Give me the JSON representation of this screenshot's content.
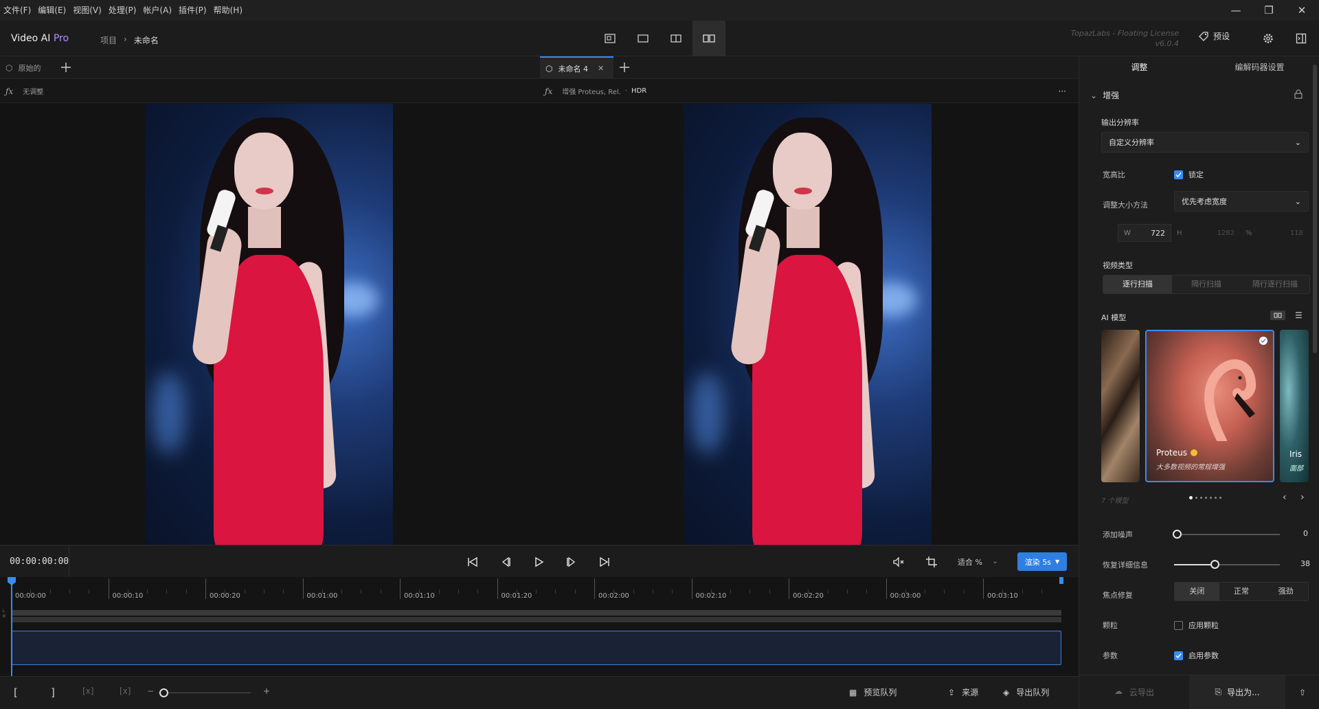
{
  "menu": [
    "文件(F)",
    "编辑(E)",
    "视图(V)",
    "处理(P)",
    "帐户(A)",
    "插件(P)",
    "帮助(H)"
  ],
  "window_controls": {
    "minimize": "—",
    "maximize": "❐",
    "close": "✕"
  },
  "header": {
    "app_name": "Video AI",
    "app_edition": "Pro",
    "breadcrumb_project": "项目",
    "breadcrumb_sep": "›",
    "breadcrumb_current": "未命名",
    "license_line1": "TopazLabs - Floating License",
    "license_line2": "v6.0.4",
    "preset_label": "预设"
  },
  "left_tab": {
    "label": "原始的",
    "adjust": "无调整"
  },
  "right_tab": {
    "label": "未命名 4",
    "adjust_prefix": "增强 Proteus, Rel.",
    "adjust_sep": "·",
    "adjust_hdr": "HDR",
    "more": "···"
  },
  "transport": {
    "timecode": "00:00:00:00",
    "fit_label": "适合 %",
    "render_label": "渲染 5s"
  },
  "timeline": {
    "ticks": [
      "00:00:00",
      "00:00:10",
      "00:00:20",
      "00:01:00",
      "00:01:10",
      "00:01:20",
      "00:02:00",
      "00:02:10",
      "00:02:20",
      "00:03:00",
      "00:03:10"
    ],
    "channel_l": "L",
    "channel_r": "R"
  },
  "bottombar": {
    "bracket_in": "[",
    "bracket_out": "]",
    "clear_in": "[x]",
    "clear_out": "[x]",
    "zoom_plus": "+",
    "zoom_minus": "−",
    "preview_queue": "预览队列",
    "source": "来源",
    "export_queue": "导出队列"
  },
  "panel": {
    "tabs": [
      "调整",
      "编解码器设置"
    ],
    "section_title": "增强",
    "output_res_label": "输出分辨率",
    "output_res_value": "自定义分辨率",
    "aspect_label": "宽高比",
    "aspect_lock_label": "锁定",
    "aspect_lock_checked": true,
    "resize_label": "调整大小方法",
    "resize_value": "优先考虑宽度",
    "w_label": "W",
    "w_value": "722",
    "h_label": "H",
    "h_value": "1282",
    "pct_label": "%",
    "pct_value": "118",
    "video_type_label": "视频类型",
    "video_types": [
      "逐行扫描",
      "隔行扫描",
      "隔行逐行扫描"
    ],
    "ai_model_label": "AI 模型",
    "models": [
      {
        "name": "",
        "desc": ""
      },
      {
        "name": "Proteus",
        "desc": "大多数视频的常规增强"
      },
      {
        "name": "Iris",
        "desc": "面部"
      }
    ],
    "model_count": "7 个模型",
    "add_noise_label": "添加噪声",
    "add_noise_value": "0",
    "add_noise_level": 0,
    "recover_detail_label": "恢复详细信息",
    "recover_detail_value": "38",
    "recover_detail_level": 0.38,
    "focus_fix_label": "焦点修复",
    "focus_fix_options": [
      "关闭",
      "正常",
      "强劲"
    ],
    "grain_label": "颗粒",
    "grain_check_label": "应用颗粒",
    "grain_checked": false,
    "params_label": "参数",
    "params_check_label": "启用参数",
    "params_checked": true,
    "cloud_export": "云导出",
    "export_as": "导出为..."
  },
  "colors": {
    "accent": "#3a8cf0",
    "pro": "#b58cff",
    "dress": "#d91540"
  }
}
